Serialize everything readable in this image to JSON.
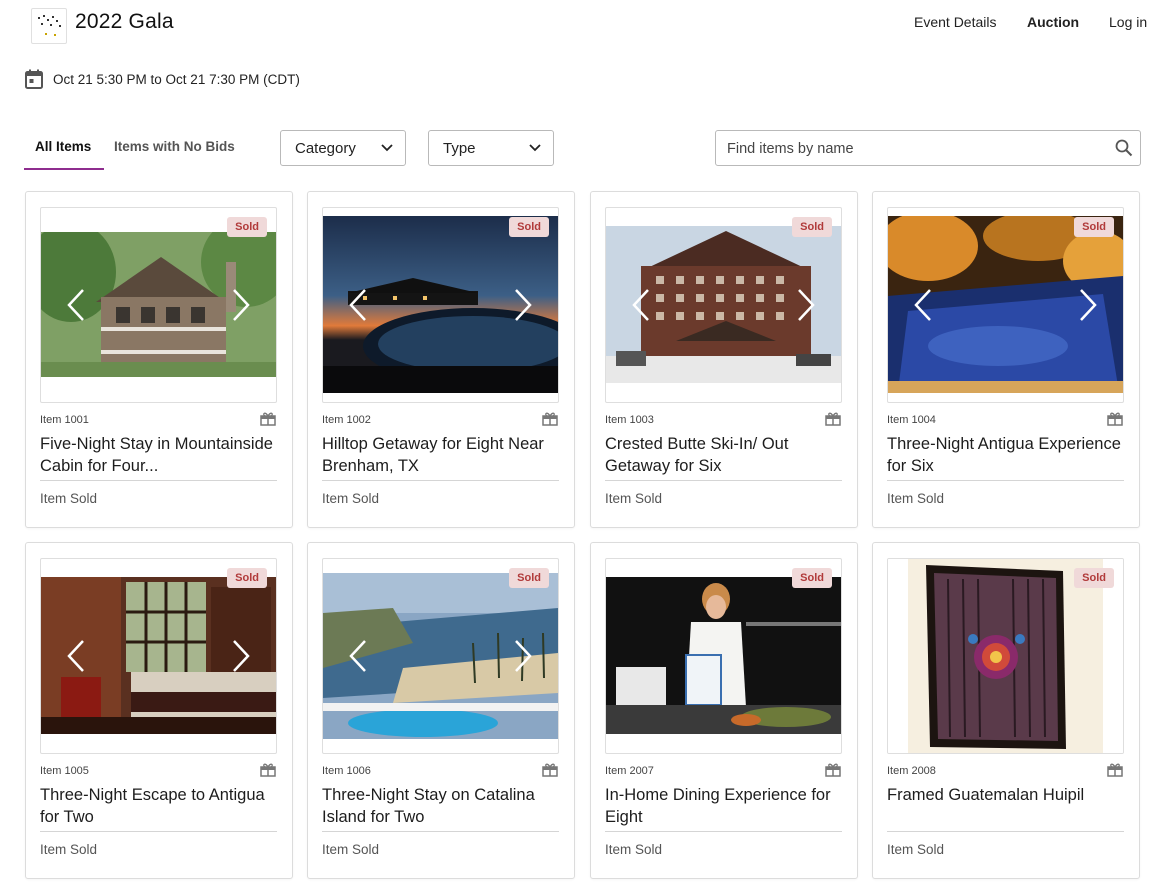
{
  "header": {
    "title": "2022 Gala",
    "nav": [
      "Event Details",
      "Auction",
      "Log in"
    ]
  },
  "event": {
    "date_range": "Oct 21 5:30 PM to Oct 21 7:30 PM (CDT)"
  },
  "toolbar": {
    "tabs": [
      "All Items",
      "Items with No Bids"
    ],
    "category_label": "Category",
    "type_label": "Type",
    "search_placeholder": "Find items by name"
  },
  "colors": {
    "accent": "#8e2d8e",
    "sold_badge_bg": "#f0d9d9",
    "sold_badge_text": "#b13a3a"
  },
  "items": [
    {
      "number": "Item 1001",
      "name": "Five-Night Stay in Mountainside Cabin for Four...",
      "badge": "Sold",
      "status": "Item Sold"
    },
    {
      "number": "Item 1002",
      "name": "Hilltop Getaway for Eight Near Brenham, TX",
      "badge": "Sold",
      "status": "Item Sold"
    },
    {
      "number": "Item 1003",
      "name": "Crested Butte Ski-In/ Out Getaway for Six",
      "badge": "Sold",
      "status": "Item Sold"
    },
    {
      "number": "Item 1004",
      "name": "Three-Night Antigua Experience for Six",
      "badge": "Sold",
      "status": "Item Sold"
    },
    {
      "number": "Item 1005",
      "name": "Three-Night Escape to Antigua for Two",
      "badge": "Sold",
      "status": "Item Sold"
    },
    {
      "number": "Item 1006",
      "name": "Three-Night Stay on Catalina Island for Two",
      "badge": "Sold",
      "status": "Item Sold"
    },
    {
      "number": "Item 2007",
      "name": "In-Home Dining Experience for Eight",
      "badge": "Sold",
      "status": "Item Sold"
    },
    {
      "number": "Item 2008",
      "name": "Framed Guatemalan Huipil",
      "badge": "Sold",
      "status": "Item Sold"
    }
  ]
}
